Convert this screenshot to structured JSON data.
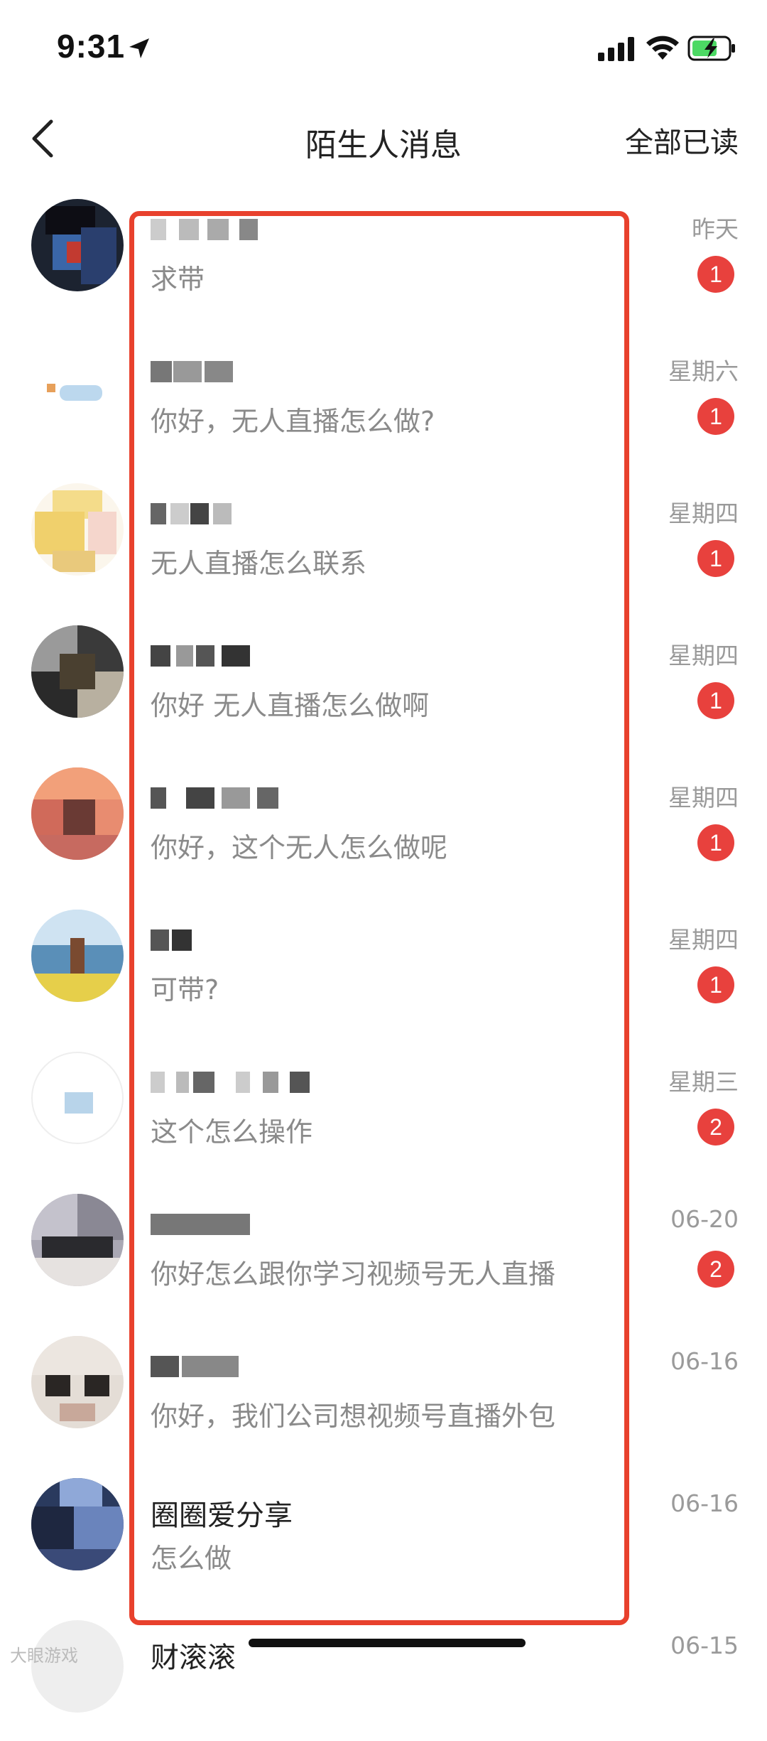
{
  "status_bar": {
    "time": "9:31"
  },
  "nav": {
    "title": "陌生人消息",
    "action": "全部已读"
  },
  "accent_color": "#e8413d",
  "messages": [
    {
      "preview": "求带",
      "date": "昨天",
      "badge": "1"
    },
    {
      "preview": "你好，无人直播怎么做?",
      "date": "星期六",
      "badge": "1"
    },
    {
      "preview": "无人直播怎么联系",
      "date": "星期四",
      "badge": "1"
    },
    {
      "preview": "你好 无人直播怎么做啊",
      "date": "星期四",
      "badge": "1"
    },
    {
      "preview": "你好，这个无人怎么做呢",
      "date": "星期四",
      "badge": "1"
    },
    {
      "preview": "可带?",
      "date": "星期四",
      "badge": "1"
    },
    {
      "preview": "这个怎么操作",
      "date": "星期三",
      "badge": "2"
    },
    {
      "preview": "你好怎么跟你学习视频号无人直播",
      "date": "06-20",
      "badge": "2"
    },
    {
      "preview": "你好，我们公司想视频号直播外包",
      "date": "06-16",
      "badge": ""
    },
    {
      "name": "圈圈爱分享",
      "preview": "怎么做",
      "date": "06-16",
      "badge": ""
    },
    {
      "name": "财滚滚",
      "preview": "",
      "date": "06-15",
      "badge": ""
    }
  ],
  "watermark": "大眼游戏"
}
